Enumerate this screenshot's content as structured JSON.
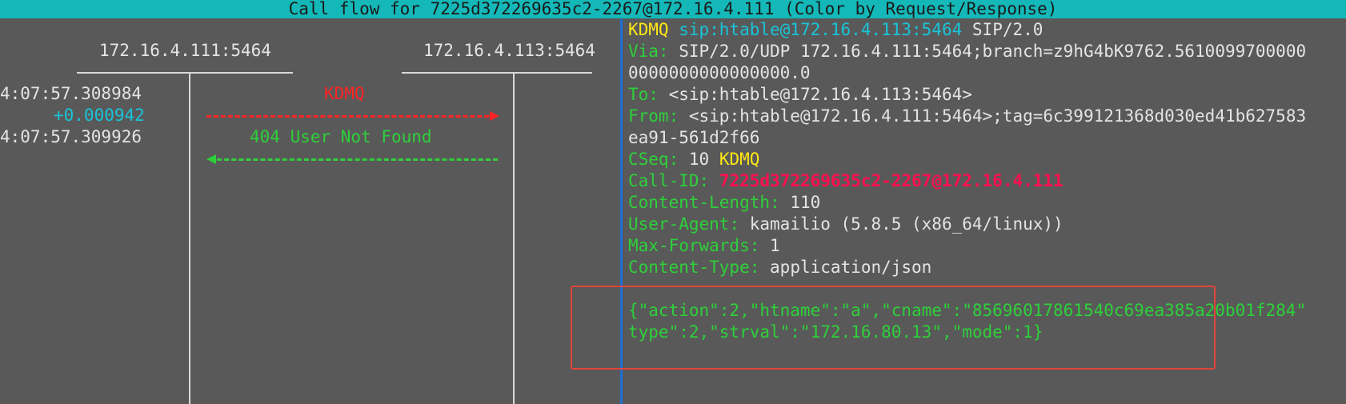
{
  "title": "Call flow for 7225d372269635c2-2267@172.16.4.111 (Color by Request/Response)",
  "hosts": {
    "left": "172.16.4.111:5464",
    "right": "172.16.4.113:5464"
  },
  "flow": {
    "time1": "4:07:57.308984",
    "delta": "+0.000942",
    "time2": "4:07:57.309926",
    "request_label": "KDMQ",
    "response_label": "404 User Not Found"
  },
  "message": {
    "request_line": {
      "method": "KDMQ",
      "uri": "sip:htable@172.16.4.113:5464",
      "version": "SIP/2.0"
    },
    "via_label": "Via:",
    "via_value": "SIP/2.0/UDP 172.16.4.111:5464;branch=z9hG4bK9762.5610099700000",
    "via_cont": "0000000000000000.0",
    "to_label": "To:",
    "to_value": "<sip:htable@172.16.4.113:5464>",
    "from_label": "From:",
    "from_value": "<sip:htable@172.16.4.111:5464>;tag=6c399121368d030ed41b627583",
    "from_cont": "ea91-561d2f66",
    "cseq_label": "CSeq:",
    "cseq_num": "10",
    "cseq_method": "KDMQ",
    "callid_label": "Call-ID:",
    "callid_value": "7225d372269635c2-2267@172.16.4.111",
    "content_length_label": "Content-Length:",
    "content_length_value": "110",
    "user_agent_label": "User-Agent:",
    "user_agent_value": "kamailio (5.8.5 (x86_64/linux))",
    "max_forwards_label": "Max-Forwards:",
    "max_forwards_value": "1",
    "content_type_label": "Content-Type:",
    "content_type_value": "application/json",
    "body_line1": "{\"action\":2,\"htname\":\"a\",\"cname\":\"85696017861540c69ea385a20b01f284\"",
    "body_line2": "type\":2,\"strval\":\"172.16.80.13\",\"mode\":1}"
  },
  "colors": {
    "title_bar": "#14b8b8",
    "background": "#595959",
    "request": "#ff2424",
    "response": "#2ed03a",
    "method": "#ffe614",
    "uri": "#19c4d8",
    "call_id": "#ff1050",
    "pane_separator": "#1f6fd6",
    "highlight": "#e0453a"
  }
}
